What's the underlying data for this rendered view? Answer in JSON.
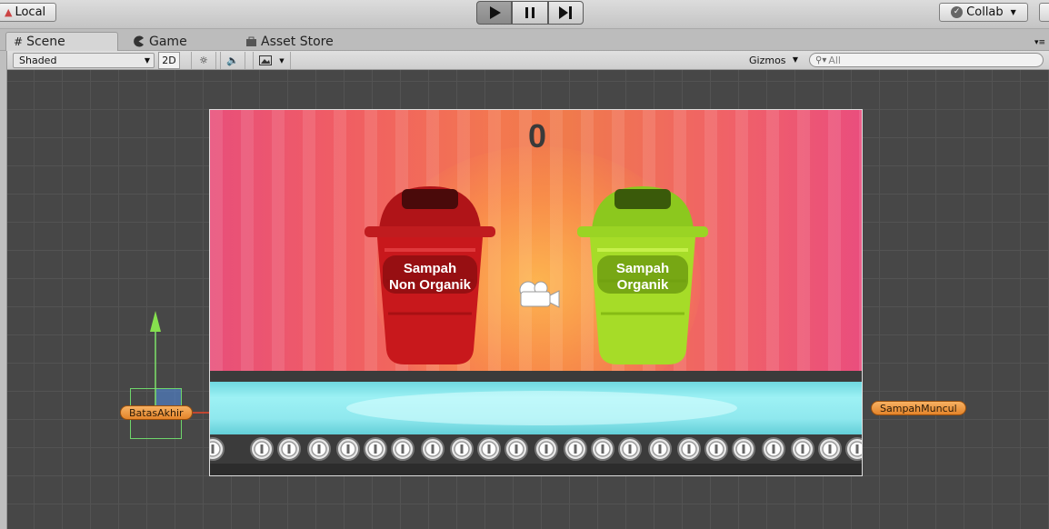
{
  "toolbar": {
    "local_label": "Local",
    "collab_label": "Collab",
    "play_buttons": [
      "play",
      "pause",
      "step"
    ]
  },
  "tabs": [
    {
      "label": "Scene",
      "icon": "grid-icon",
      "active": true
    },
    {
      "label": "Game",
      "icon": "pacman-icon",
      "active": false
    },
    {
      "label": "Asset Store",
      "icon": "bag-icon",
      "active": false
    }
  ],
  "scene_toolbar": {
    "shading_mode": "Shaded",
    "mode_2d": "2D",
    "gizmos_label": "Gizmos",
    "search_placeholder": "All"
  },
  "game": {
    "score": "0",
    "bins": [
      {
        "line1": "Sampah",
        "line2": "Non Organik",
        "color": "#c8181c"
      },
      {
        "line1": "Sampah",
        "line2": "Organik",
        "color": "#9bd422"
      }
    ]
  },
  "scene_objects": {
    "left_label": "BatasAkhir",
    "right_label": "SampahMuncul"
  },
  "colors": {
    "viewport_bg": "#474747",
    "label_orange": "#e4842a",
    "gizmo_green": "#6fd56b",
    "gizmo_red": "#e8462a"
  }
}
